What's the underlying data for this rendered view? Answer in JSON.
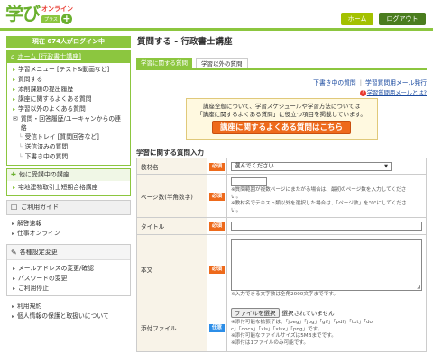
{
  "header": {
    "logo_main": "学び",
    "logo_online": "オンライン",
    "logo_tag": "プラス",
    "logo_plus": "+",
    "home_label": "ホーム",
    "logout_label": "ログアウト"
  },
  "sidebar": {
    "login_status": "現在 674人がログイン中",
    "course_box": {
      "title": "ホーム [行政書士講座]",
      "items": [
        {
          "label": "学習メニュー [テスト&動画など]"
        },
        {
          "label": "質問する"
        },
        {
          "label": "添削課題の提出履歴"
        },
        {
          "label": "講座に関するよくある質問"
        },
        {
          "label": "学習以外のよくある質問"
        }
      ],
      "history_label": "質問・回答履歴/ユーキャンからの連絡",
      "history_items": [
        {
          "label": "受信トレイ [質問回答など]"
        },
        {
          "label": "送信済みの質問"
        },
        {
          "label": "下書き中の質問"
        }
      ]
    },
    "enrolled_box": {
      "title": "他に受講中の講座",
      "items": [
        {
          "label": "宅地建物取引士短期合格講座"
        }
      ]
    },
    "guide_box": {
      "title": "ご利用ガイド",
      "items": [
        {
          "label": "解答速報"
        },
        {
          "label": "仕事オンライン"
        }
      ]
    },
    "settings_box": {
      "title": "各種設定変更",
      "items": [
        {
          "label": "メールアドレスの変更/確認"
        },
        {
          "label": "パスワードの変更"
        },
        {
          "label": "ご利用停止"
        }
      ]
    },
    "footer_items": [
      {
        "label": "利用規約"
      },
      {
        "label": "個人情報の保護と取扱いについて"
      }
    ]
  },
  "main": {
    "page_title": "質問する - 行政書士講座",
    "tabs": [
      {
        "label": "学習に関する質問",
        "active": true
      },
      {
        "label": "学習以外の質問",
        "active": false
      }
    ],
    "links": {
      "drafts": "下書き中の質問",
      "sep": "|",
      "mail": "学習質問用メール発行",
      "help": "学習質問用メールとは?",
      "help_icon": "?"
    },
    "notice": {
      "line1": "講座全般について、学習スケジュールや学習方法については",
      "line2": "「講座に関するよくある質問」に役立つ項目を掲載しています。",
      "button": "講座に関するよくある質問はこちら"
    },
    "form_title": "学習に関する質問入力",
    "required_label": "必須",
    "optional_label": "任意",
    "fields": {
      "textbook": {
        "label": "教材名",
        "placeholder": "選んでください"
      },
      "page": {
        "label": "ページ数(半角数字)",
        "note1": "※質問範囲が複数ページにまたがる場合は、最初のページ数を入力してくださ",
        "note1b": "い。",
        "note2": "※教材名でテキスト類以外を選択した場合は、「ページ数」を\"0\"にしてくださ",
        "note2b": "い。"
      },
      "title": {
        "label": "タイトル"
      },
      "body": {
        "label": "本文",
        "note": "※入力できる文字数は全角2000文字までです。"
      },
      "attachment": {
        "label": "添付ファイル",
        "button": "ファイルを選択",
        "status": "選択されていません",
        "note1": "※添付可能な拡張子は、「jpeg」「jpg」「gif」「pdf」「txt」「do",
        "note1b": "c」「docx」「xls」「xlsx」「png」です。",
        "note2": "※添付可能なファイルサイズは5MBまでです。",
        "note3": "※添付は1ファイルのみ可能です。"
      }
    }
  },
  "colors": {
    "brand_green": "#8cc63f",
    "dark_green": "#4a7d1e",
    "orange": "#ee6a1b",
    "blue": "#2c8ee8"
  }
}
